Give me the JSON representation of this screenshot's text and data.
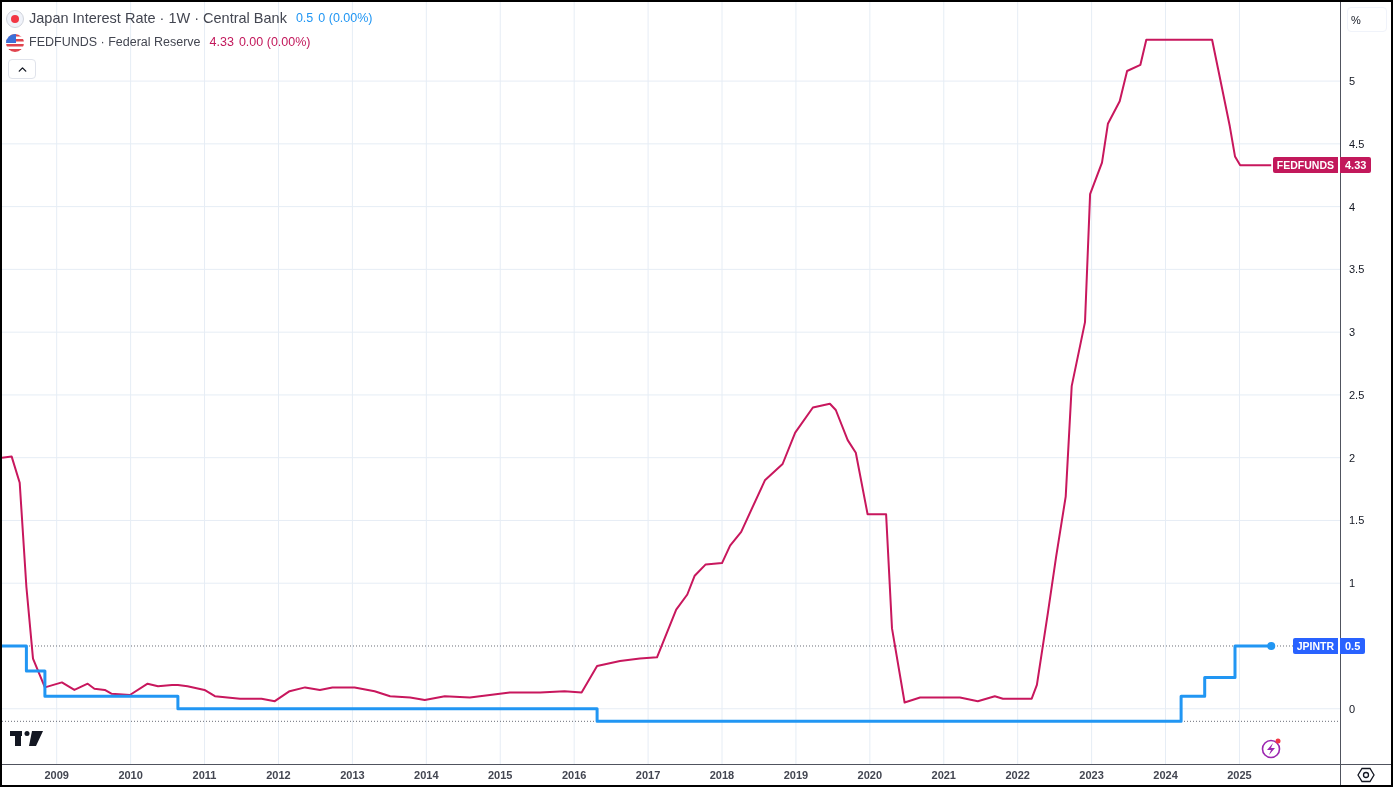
{
  "legend": [
    {
      "kind": "japan",
      "title": "Japan Interest Rate · 1W · Central Bank",
      "value": "0.5",
      "change": "0 (0.00%)",
      "color": "#2196f3"
    },
    {
      "kind": "usa",
      "title": "FEDFUNDS · Federal Reserve",
      "value": "4.33",
      "change": "0.00 (0.00%)",
      "color": "#c2185b"
    }
  ],
  "axis_unit": "%",
  "price_labels": [
    {
      "value": "4.33",
      "color": "#c2185b",
      "dot": false
    },
    {
      "value": "0.5",
      "color": "#2962ff",
      "dot": true
    }
  ],
  "chart_data": {
    "type": "line",
    "grid": true,
    "xlim": [
      2008.26,
      2027.05
    ],
    "ylim": [
      -0.44,
      5.63
    ],
    "xticks": [
      2009,
      2010,
      2011,
      2012,
      2013,
      2014,
      2015,
      2016,
      2017,
      2018,
      2019,
      2020,
      2021,
      2022,
      2023,
      2024,
      2025
    ],
    "yticks": [
      0,
      1,
      1.5,
      2,
      2.5,
      3,
      3.5,
      4,
      4.5,
      5
    ],
    "ref_lines": [
      {
        "axis": "y",
        "value": 0.5
      },
      {
        "axis": "y",
        "value": -0.1
      }
    ],
    "x": [
      2008.26,
      2008.39,
      2008.5,
      2008.59,
      2008.59,
      2008.68,
      2008.84,
      2008.84,
      2009.07,
      2009.24,
      2009.42,
      2009.51,
      2009.65,
      2009.74,
      2009.99,
      2010.23,
      2010.37,
      2010.56,
      2010.64,
      2010.64,
      2010.77,
      2011.0,
      2011.14,
      2011.48,
      2011.77,
      2011.95,
      2012.15,
      2012.36,
      2012.56,
      2012.73,
      2013.03,
      2013.3,
      2013.51,
      2013.78,
      2013.98,
      2014.25,
      2014.59,
      2015.13,
      2015.54,
      2015.87,
      2016.1,
      2016.31,
      2016.31,
      2016.62,
      2016.89,
      2017.12,
      2017.38,
      2017.53,
      2017.63,
      2017.78,
      2018.0,
      2018.11,
      2018.26,
      2018.58,
      2018.82,
      2018.99,
      2019.23,
      2019.46,
      2019.54,
      2019.7,
      2019.81,
      2019.97,
      2020.22,
      2020.3,
      2020.47,
      2020.68,
      2021.22,
      2021.46,
      2021.69,
      2021.8,
      2022.19,
      2022.26,
      2022.41,
      2022.52,
      2022.65,
      2022.73,
      2022.91,
      2022.98,
      2023.14,
      2023.22,
      2023.38,
      2023.48,
      2023.66,
      2023.74,
      2024.21,
      2024.21,
      2024.53,
      2024.53,
      2024.63,
      2024.71,
      2024.87,
      2024.94,
      2024.94,
      2025.01,
      2025.43
    ],
    "series": [
      {
        "name": "FEDFUNDS",
        "color": "#c8175d",
        "values": [
          2.0,
          2.01,
          1.8,
          0.97,
          0.97,
          0.4,
          0.17,
          0.17,
          0.21,
          0.15,
          0.2,
          0.16,
          0.15,
          0.12,
          0.11,
          0.2,
          0.18,
          0.19,
          0.19,
          0.19,
          0.18,
          0.15,
          0.1,
          0.08,
          0.08,
          0.06,
          0.14,
          0.17,
          0.15,
          0.17,
          0.17,
          0.14,
          0.1,
          0.09,
          0.07,
          0.1,
          0.09,
          0.13,
          0.13,
          0.14,
          0.13,
          0.34,
          0.34,
          0.38,
          0.4,
          0.41,
          0.79,
          0.91,
          1.06,
          1.15,
          1.16,
          1.3,
          1.41,
          1.82,
          1.95,
          2.2,
          2.4,
          2.43,
          2.38,
          2.14,
          2.04,
          1.55,
          1.55,
          0.64,
          0.05,
          0.09,
          0.09,
          0.06,
          0.1,
          0.08,
          0.08,
          0.19,
          0.77,
          1.21,
          1.69,
          2.57,
          3.08,
          4.1,
          4.35,
          4.66,
          4.84,
          5.08,
          5.13,
          5.33,
          5.33,
          5.33,
          5.33,
          5.33,
          5.33,
          5.1,
          4.64,
          4.4,
          4.4,
          4.33,
          4.33
        ]
      },
      {
        "name": "JPINTR",
        "color": "#2196f3",
        "values": [
          0.5,
          0.5,
          0.5,
          0.5,
          0.3,
          0.3,
          0.3,
          0.1,
          0.1,
          0.1,
          0.1,
          0.1,
          0.1,
          0.1,
          0.1,
          0.1,
          0.1,
          0.1,
          0.1,
          0,
          0,
          0,
          0,
          0,
          0,
          0,
          0,
          0,
          0,
          0,
          0,
          0,
          0,
          0,
          0,
          0,
          0,
          0,
          0,
          0,
          0,
          0,
          -0.1,
          -0.1,
          -0.1,
          -0.1,
          -0.1,
          -0.1,
          -0.1,
          -0.1,
          -0.1,
          -0.1,
          -0.1,
          -0.1,
          -0.1,
          -0.1,
          -0.1,
          -0.1,
          -0.1,
          -0.1,
          -0.1,
          -0.1,
          -0.1,
          -0.1,
          -0.1,
          -0.1,
          -0.1,
          -0.1,
          -0.1,
          -0.1,
          -0.1,
          -0.1,
          -0.1,
          -0.1,
          -0.1,
          -0.1,
          -0.1,
          -0.1,
          -0.1,
          -0.1,
          -0.1,
          -0.1,
          -0.1,
          -0.1,
          -0.1,
          0.1,
          0.1,
          0.25,
          0.25,
          0.25,
          0.25,
          0.25,
          0.5,
          0.5,
          0.5
        ]
      }
    ]
  }
}
